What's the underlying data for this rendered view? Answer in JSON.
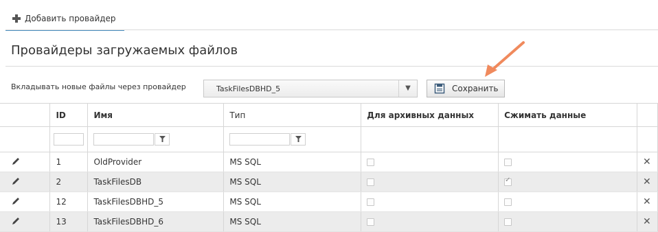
{
  "toolbar": {
    "add_label": "Добавить провайдер"
  },
  "page": {
    "title": "Провайдеры загружаемых файлов"
  },
  "provider": {
    "label": "Вкладывать новые файлы через провайдер",
    "selected": "TaskFilesDBHD_5",
    "dropdown_icon": "▼"
  },
  "save": {
    "label": "Сохранить",
    "icon": "save-icon"
  },
  "annotation": {
    "color": "#f08a5d"
  },
  "table": {
    "headers": [
      "",
      "ID",
      "Имя",
      "Тип",
      "Для архивных данных",
      "Сжимать данные",
      ""
    ],
    "rows": [
      {
        "id": "1",
        "name": "OldProvider",
        "type": "MS SQL",
        "archive": false,
        "compress": false
      },
      {
        "id": "2",
        "name": "TaskFilesDB",
        "type": "MS SQL",
        "archive": false,
        "compress": true
      },
      {
        "id": "12",
        "name": "TaskFilesDBHD_5",
        "type": "MS SQL",
        "archive": false,
        "compress": false
      },
      {
        "id": "13",
        "name": "TaskFilesDBHD_6",
        "type": "MS SQL",
        "archive": false,
        "compress": false
      }
    ],
    "delete_glyph": "✕",
    "edit_icon": "pencil-icon",
    "filter_icon": "filter-icon"
  }
}
